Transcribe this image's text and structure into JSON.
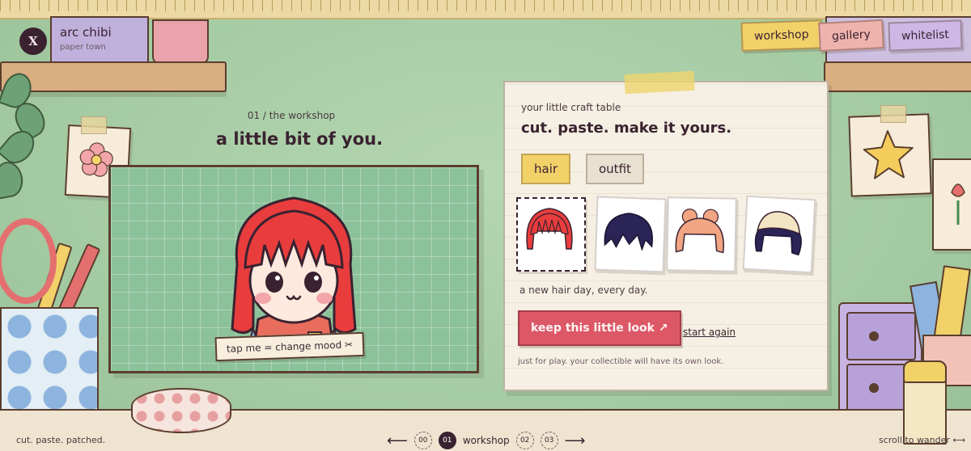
{
  "brand": {
    "name": "arc chibi",
    "subtitle": "paper town",
    "logo": "X"
  },
  "nav": {
    "workshop": "workshop",
    "gallery": "gallery",
    "whitelist": "whitelist"
  },
  "stage": {
    "eyebrow": "01 / the workshop",
    "headline": "a little bit of you.",
    "mood_tag": "tap me = change mood ✂"
  },
  "card": {
    "eyebrow": "your little craft table",
    "title": "cut. paste. make it yours.",
    "tabs": {
      "hair": "hair",
      "outfit": "outfit"
    },
    "hint": "a new hair day, every day.",
    "keep_label": "keep this little look ↗",
    "start_again": "start again",
    "fine_print": "just for play. your collectible will have its own look."
  },
  "colors": {
    "accent_red": "#dc5867",
    "accent_yellow": "#f2d169",
    "accent_pink": "#efb3ae",
    "accent_lilac": "#cdb7e5",
    "hair_red": "#e93d3d",
    "hair_navy": "#2b2456",
    "hair_peach": "#f1a582",
    "hair_cream": "#f3e5c4"
  },
  "footer": {
    "left": "cut. paste. patched.",
    "right": "scroll to wander ⟷",
    "pager": {
      "prev": "⟵",
      "next": "⟶",
      "p0": "00",
      "p1": "01",
      "p1_label": "workshop",
      "p2": "02",
      "p3": "03"
    }
  }
}
